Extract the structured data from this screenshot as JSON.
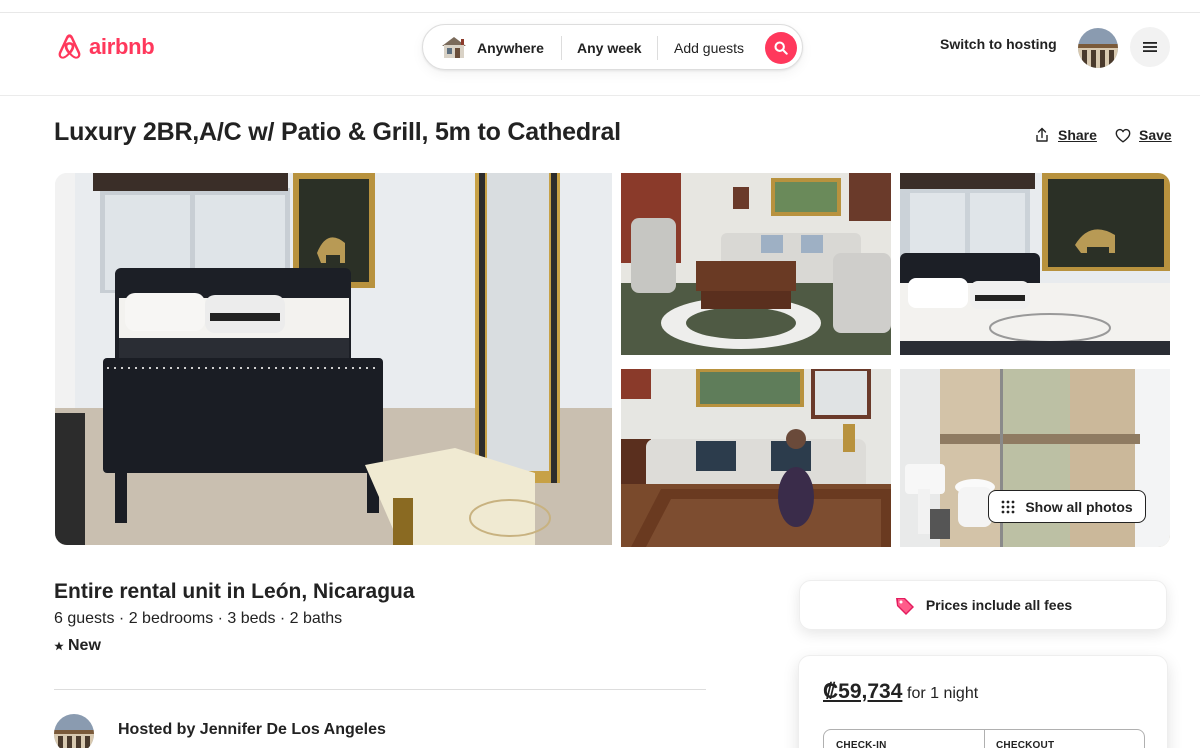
{
  "brand": {
    "name": "airbnb",
    "color": "#FF385C"
  },
  "search": {
    "where": "Anywhere",
    "when": "Any week",
    "who": "Add guests",
    "thumb_icon": "house-thumbnail-icon",
    "button_icon": "search-icon"
  },
  "header": {
    "switch_hosting": "Switch to hosting",
    "menu_icon": "hamburger-menu-icon"
  },
  "listing": {
    "title": "Luxury 2BR,A/C w/ Patio & Grill, 5m to Cathedral",
    "share": "Share",
    "save": "Save",
    "show_all_photos": "Show all photos",
    "type_title": "Entire rental unit in León, Nicaragua",
    "specs": "6 guests · 2 bedrooms · 3 beds · 2 baths",
    "rating_label": "New",
    "host_line": "Hosted by Jennifer De Los Angeles"
  },
  "booking": {
    "fees_notice": "Prices include all fees",
    "price": "₡59,734",
    "price_period": "for 1 night",
    "checkin_label": "CHECK-IN",
    "checkout_label": "CHECKOUT"
  },
  "photos": [
    {
      "subject": "bedroom with black tufted bed and gold mirror"
    },
    {
      "subject": "living room with sofas and wooden coffee table"
    },
    {
      "subject": "bedroom with horse painting"
    },
    {
      "subject": "living room with glass table and statue"
    },
    {
      "subject": "bathroom with glass shower"
    }
  ]
}
